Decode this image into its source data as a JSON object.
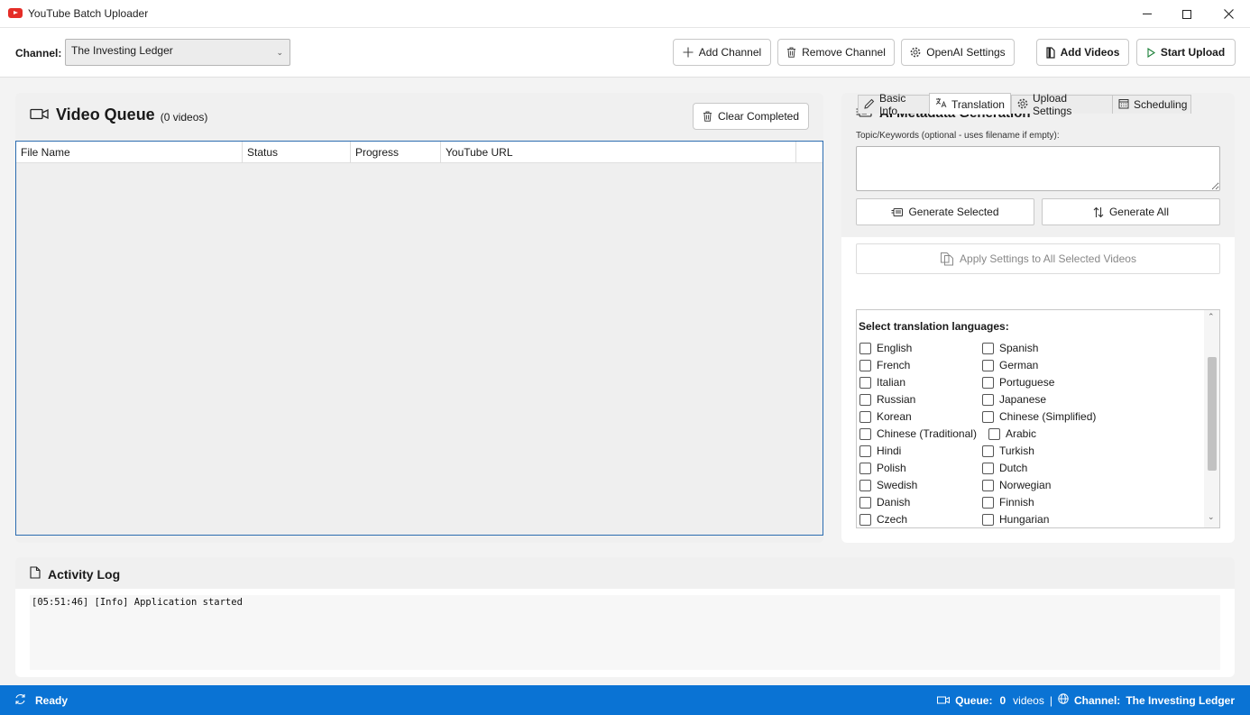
{
  "window": {
    "title": "YouTube Batch Uploader"
  },
  "toolbar": {
    "channel_label": "Channel:",
    "channel_value": "The Investing Ledger",
    "add_channel": "Add Channel",
    "remove_channel": "Remove Channel",
    "openai_settings": "OpenAI Settings",
    "add_videos": "Add Videos",
    "start_upload": "Start Upload"
  },
  "queue": {
    "title": "Video Queue",
    "count": "(0 videos)",
    "clear_completed": "Clear Completed",
    "columns": [
      "File Name",
      "Status",
      "Progress",
      "YouTube URL"
    ]
  },
  "ai": {
    "title": "AI Metadata Generation",
    "hint": "Topic/Keywords (optional - uses filename if empty):",
    "topic_value": "",
    "generate_selected": "Generate Selected",
    "generate_all": "Generate All",
    "apply_settings": "Apply Settings to All Selected Videos",
    "tabs": [
      "Basic Info",
      "Translation",
      "Upload Settings",
      "Scheduling"
    ],
    "active_tab": "Translation",
    "translation_heading": "Select translation languages:",
    "languages_left": [
      "English",
      "French",
      "Italian",
      "Russian",
      "Korean",
      "Chinese (Traditional)",
      "Hindi",
      "Polish",
      "Swedish",
      "Danish",
      "Czech"
    ],
    "languages_right": [
      "Spanish",
      "German",
      "Portuguese",
      "Japanese",
      "Chinese (Simplified)",
      "Arabic",
      "Turkish",
      "Dutch",
      "Norwegian",
      "Finnish",
      "Hungarian"
    ]
  },
  "log": {
    "title": "Activity Log",
    "lines": [
      "[05:51:46] [Info] Application started"
    ]
  },
  "status": {
    "ready": "Ready",
    "queue_label": "Queue:",
    "queue_count": "0",
    "queue_unit": "videos",
    "separator": "|",
    "channel_label": "Channel:",
    "channel_value": "The Investing Ledger"
  },
  "colors": {
    "accent": "#0a73d4",
    "brand": "#e52d27"
  }
}
